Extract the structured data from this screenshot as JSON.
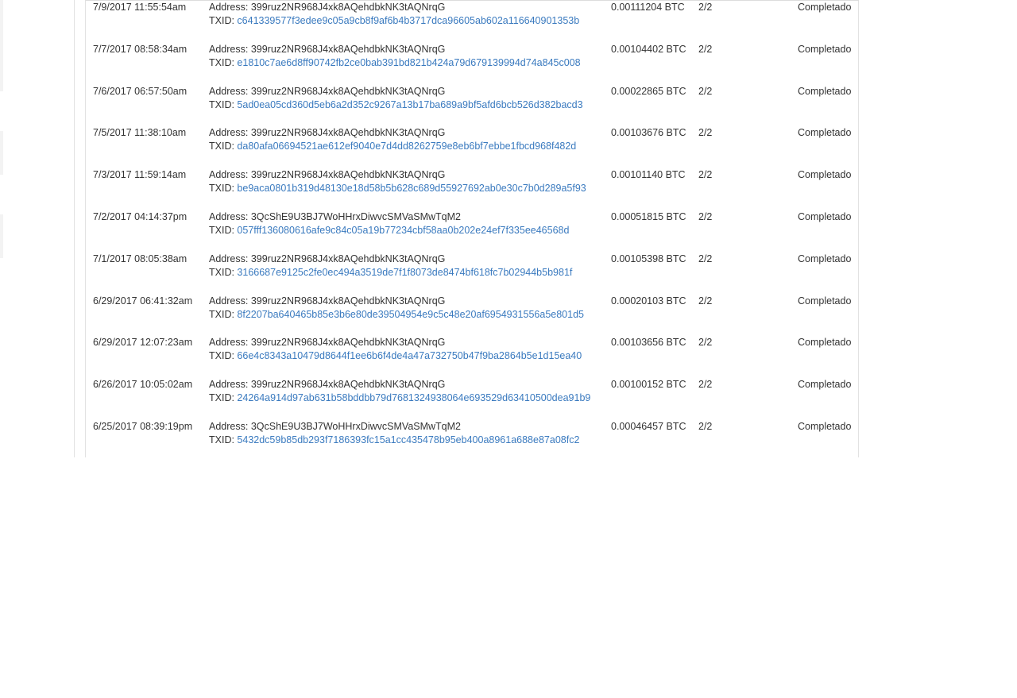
{
  "labels": {
    "address_prefix": "Address: ",
    "txid_prefix": "TXID: "
  },
  "colors": {
    "link": "#3a7abf",
    "text": "#333333",
    "border": "#e2e2e2"
  },
  "transactions": [
    {
      "date": "7/9/2017 11:55:54am",
      "address": "399ruz2NR968J4xk8AQehdbkNK3tAQNrqG",
      "txid": "c641339577f3edee9c05a9cb8f9af6b4b3717dca96605ab602a116640901353b",
      "amount": "0.00111204 BTC",
      "confirmations": "2/2",
      "status": "Completado"
    },
    {
      "date": "7/7/2017 08:58:34am",
      "address": "399ruz2NR968J4xk8AQehdbkNK3tAQNrqG",
      "txid": "e1810c7ae6d8ff90742fb2ce0bab391bd821b424a79d679139994d74a845c008",
      "amount": "0.00104402 BTC",
      "confirmations": "2/2",
      "status": "Completado"
    },
    {
      "date": "7/6/2017 06:57:50am",
      "address": "399ruz2NR968J4xk8AQehdbkNK3tAQNrqG",
      "txid": "5ad0ea05cd360d5eb6a2d352c9267a13b17ba689a9bf5afd6bcb526d382bacd3",
      "amount": "0.00022865 BTC",
      "confirmations": "2/2",
      "status": "Completado"
    },
    {
      "date": "7/5/2017 11:38:10am",
      "address": "399ruz2NR968J4xk8AQehdbkNK3tAQNrqG",
      "txid": "da80afa06694521ae612ef9040e7d4dd8262759e8eb6bf7ebbe1fbcd968f482d",
      "amount": "0.00103676 BTC",
      "confirmations": "2/2",
      "status": "Completado"
    },
    {
      "date": "7/3/2017 11:59:14am",
      "address": "399ruz2NR968J4xk8AQehdbkNK3tAQNrqG",
      "txid": "be9aca0801b319d48130e18d58b5b628c689d55927692ab0e30c7b0d289a5f93",
      "amount": "0.00101140 BTC",
      "confirmations": "2/2",
      "status": "Completado"
    },
    {
      "date": "7/2/2017 04:14:37pm",
      "address": "3QcShE9U3BJ7WoHHrxDiwvcSMVaSMwTqM2",
      "txid": "057fff136080616afe9c84c05a19b77234cbf58aa0b202e24ef7f335ee46568d",
      "amount": "0.00051815 BTC",
      "confirmations": "2/2",
      "status": "Completado"
    },
    {
      "date": "7/1/2017 08:05:38am",
      "address": "399ruz2NR968J4xk8AQehdbkNK3tAQNrqG",
      "txid": "3166687e9125c2fe0ec494a3519de7f1f8073de8474bf618fc7b02944b5b981f",
      "amount": "0.00105398 BTC",
      "confirmations": "2/2",
      "status": "Completado"
    },
    {
      "date": "6/29/2017 06:41:32am",
      "address": "399ruz2NR968J4xk8AQehdbkNK3tAQNrqG",
      "txid": "8f2207ba640465b85e3b6e80de39504954e9c5c48e20af6954931556a5e801d5",
      "amount": "0.00020103 BTC",
      "confirmations": "2/2",
      "status": "Completado"
    },
    {
      "date": "6/29/2017 12:07:23am",
      "address": "399ruz2NR968J4xk8AQehdbkNK3tAQNrqG",
      "txid": "66e4c8343a10479d8644f1ee6b6f4de4a47a732750b47f9ba2864b5e1d15ea40",
      "amount": "0.00103656 BTC",
      "confirmations": "2/2",
      "status": "Completado"
    },
    {
      "date": "6/26/2017 10:05:02am",
      "address": "399ruz2NR968J4xk8AQehdbkNK3tAQNrqG",
      "txid": "24264a914d97ab631b58bddbb79d7681324938064e693529d63410500dea91b9",
      "amount": "0.00100152 BTC",
      "confirmations": "2/2",
      "status": "Completado"
    },
    {
      "date": "6/25/2017 08:39:19pm",
      "address": "3QcShE9U3BJ7WoHHrxDiwvcSMVaSMwTqM2",
      "txid": "5432dc59b85db293f7186393fc15a1cc435478b95eb400a8961a688e87a08fc2",
      "amount": "0.00046457 BTC",
      "confirmations": "2/2",
      "status": "Completado"
    }
  ]
}
